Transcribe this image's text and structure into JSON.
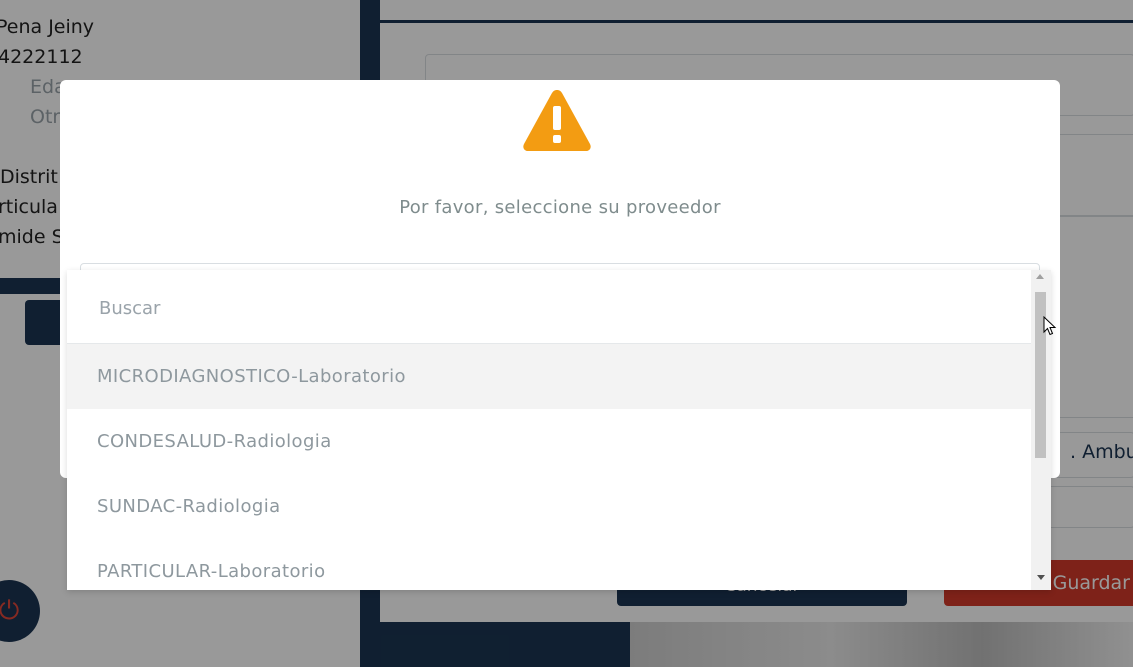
{
  "background": {
    "patient_name": "Pena Jeiny",
    "patient_id": "4222112",
    "age_label": "Eda",
    "other_label": "Otr",
    "district": "Distrit",
    "particular": "rticula",
    "pyramid": "mide S",
    "ambulatory": ". Ambul",
    "cancel_label": "Cancelar",
    "save_label": "Guardar"
  },
  "modal": {
    "icon": "warning-triangle-icon",
    "message": "Por favor, seleccione su proveedor"
  },
  "dropdown": {
    "search_placeholder": "Buscar",
    "options": [
      "MICRODIAGNOSTICO-Laboratorio",
      "CONDESALUD-Radiologia",
      "SUNDAC-Radiologia",
      "PARTICULAR-Laboratorio"
    ]
  },
  "colors": {
    "navy": "#1b3552",
    "warning": "#f39c12",
    "danger": "#d33a2a",
    "option_text": "#8e989e"
  }
}
